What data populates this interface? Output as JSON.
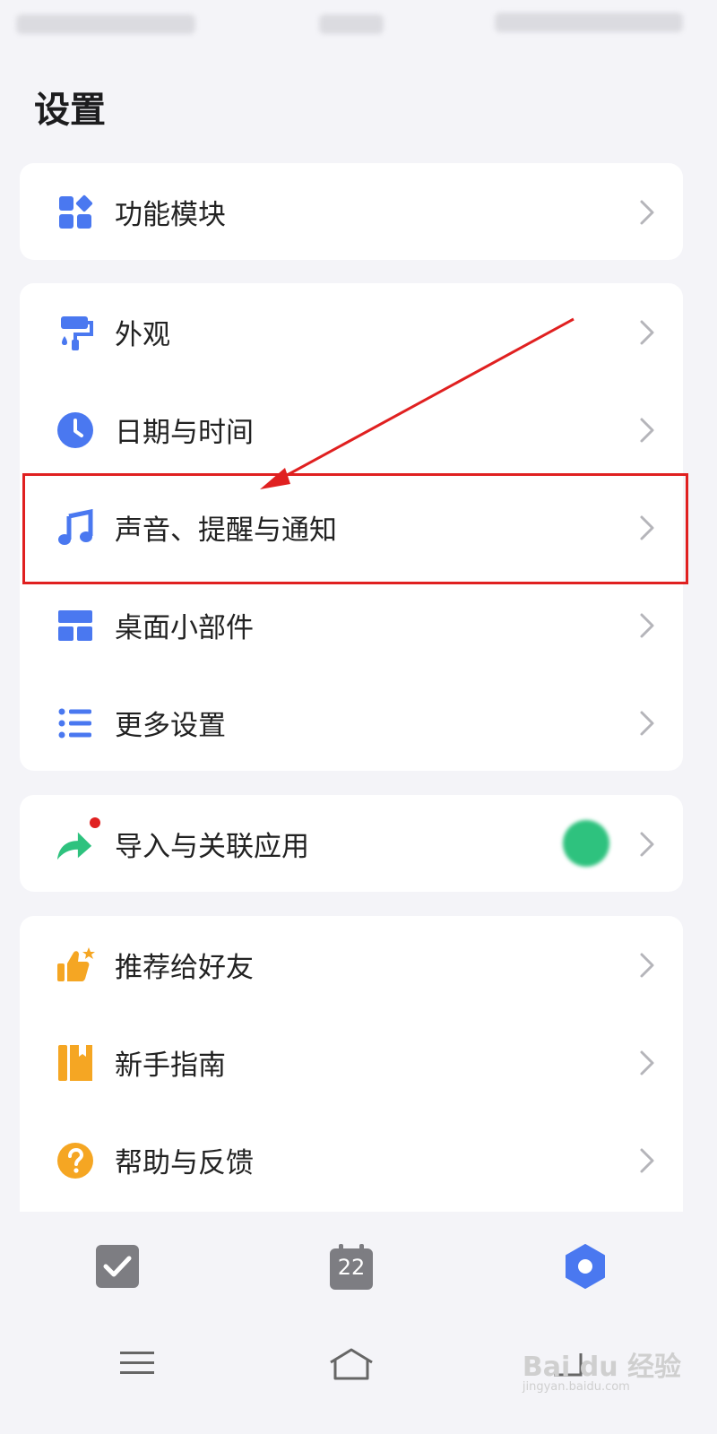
{
  "page": {
    "title": "设置"
  },
  "cards": [
    {
      "items": [
        {
          "label": "功能模块",
          "icon": "grid-icon"
        }
      ]
    },
    {
      "items": [
        {
          "label": "外观",
          "icon": "paint-roller-icon"
        },
        {
          "label": "日期与时间",
          "icon": "clock-icon"
        },
        {
          "label": "声音、提醒与通知",
          "icon": "music-note-icon"
        },
        {
          "label": "桌面小部件",
          "icon": "widget-icon"
        },
        {
          "label": "更多设置",
          "icon": "list-icon"
        }
      ]
    },
    {
      "items": [
        {
          "label": "导入与关联应用",
          "icon": "share-arrow-icon"
        }
      ]
    },
    {
      "items": [
        {
          "label": "推荐给好友",
          "icon": "thumbs-up-icon"
        },
        {
          "label": "新手指南",
          "icon": "book-icon"
        },
        {
          "label": "帮助与反馈",
          "icon": "question-icon"
        }
      ]
    }
  ],
  "tabbar": {
    "calendar_day": "22"
  },
  "watermark": {
    "text": "Bai du 经验",
    "sub": "jingyan.baidu.com"
  },
  "colors": {
    "accent": "#4a78f0",
    "highlight": "#e02020",
    "orange": "#f5a623",
    "green": "#2ec27e"
  }
}
